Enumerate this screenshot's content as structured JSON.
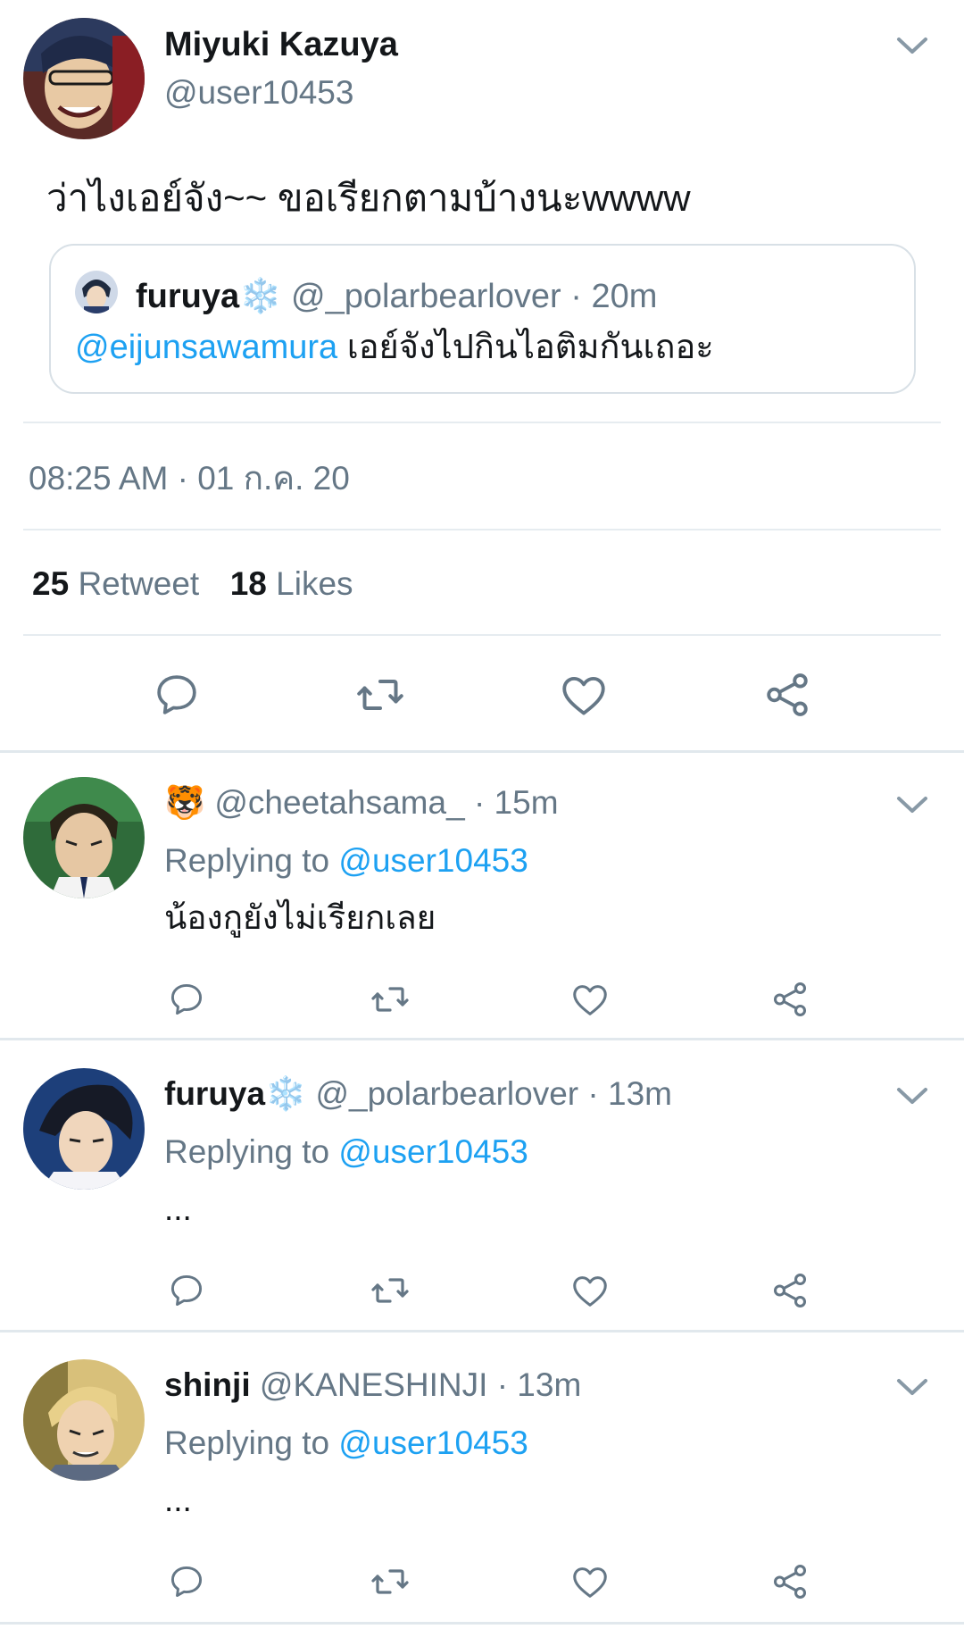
{
  "main_tweet": {
    "display_name": "Miyuki Kazuya",
    "handle": "@user10453",
    "text": "ว่าไงเอย์จัง~~ ขอเรียกตามบ้างนะwwww",
    "quoted": {
      "display_name": "furuya",
      "name_emoji": "❄️",
      "handle": "@_polarbearlover",
      "time": "· 20m",
      "mention": "@eijunsawamura",
      "text": "เอย์จังไปกินไอติมกันเถอะ"
    },
    "timestamp": "08:25 AM · 01 ก.ค. 20",
    "retweet_count": "25",
    "retweet_label": "Retweet",
    "like_count": "18",
    "like_label": "Likes"
  },
  "replies": [
    {
      "display_name": "",
      "name_emoji": "🐯",
      "handle": "@cheetahsama_",
      "time": "· 15m",
      "replying_label": "Replying to",
      "replying_handle": "@user10453",
      "text": "น้องกูยังไม่เรียกเลย"
    },
    {
      "display_name": "furuya",
      "name_emoji": "❄️",
      "handle": "@_polarbearlover",
      "time": "· 13m",
      "replying_label": "Replying to",
      "replying_handle": "@user10453",
      "text": "..."
    },
    {
      "display_name": "shinji",
      "name_emoji": "",
      "handle": "@KANESHINJI",
      "time": "· 13m",
      "replying_label": "Replying to",
      "replying_handle": "@user10453",
      "text": "..."
    }
  ],
  "icons": [
    "chevron-down-icon",
    "reply-icon",
    "retweet-icon",
    "like-icon",
    "share-icon",
    "snowflake-icon",
    "tiger-icon"
  ],
  "colors": {
    "link": "#1da1f2",
    "muted": "#657786",
    "icon": "#657786",
    "divider": "#e6ecf0"
  }
}
